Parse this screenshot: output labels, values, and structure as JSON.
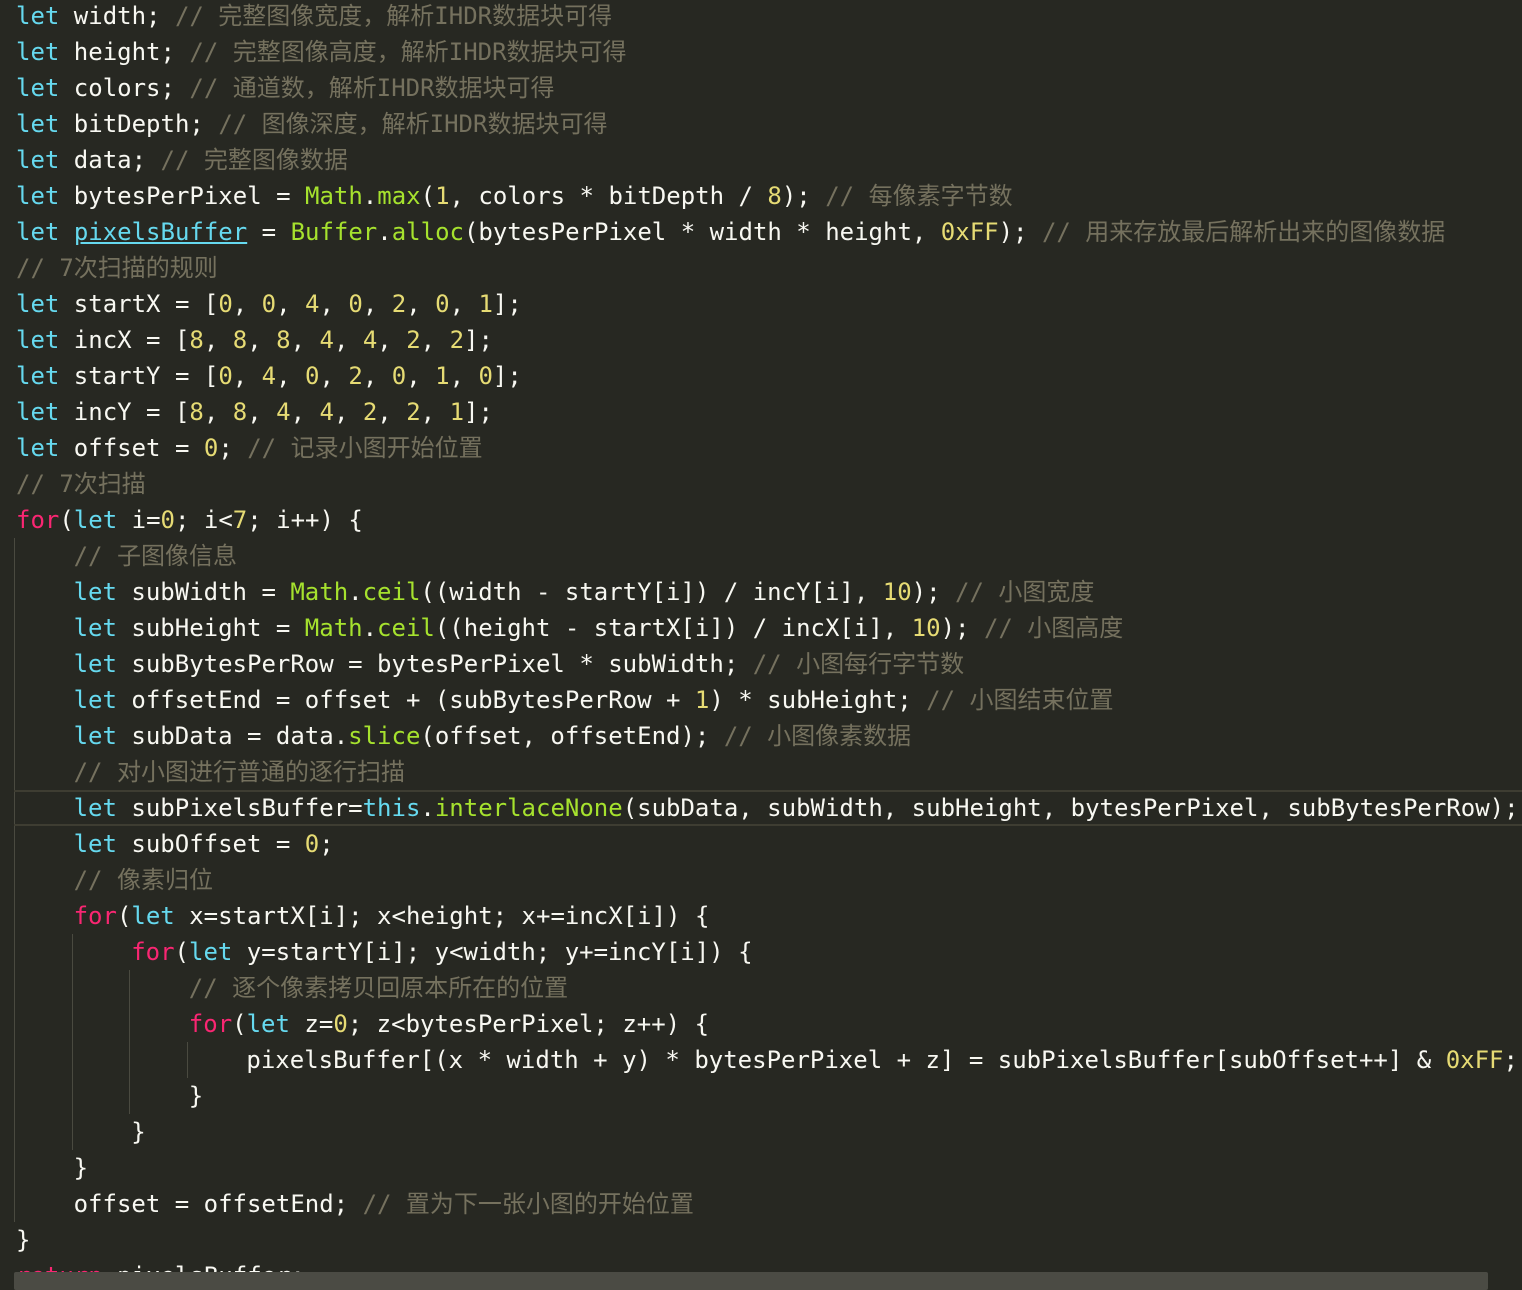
{
  "editor": {
    "language": "javascript",
    "colors": {
      "background": "#272822",
      "keyword": "#66d9ef",
      "control": "#f92672",
      "function": "#a6e22e",
      "number": "#e6db74",
      "comment": "#75715e",
      "text": "#f8f8f2"
    },
    "current_line_index": 22,
    "lines": [
      {
        "indent": 0,
        "tokens": [
          {
            "t": "let",
            "c": "kw"
          },
          {
            "t": " width; ",
            "c": "plain"
          },
          {
            "t": "// 完整图像宽度，解析IHDR数据块可得",
            "c": "cm"
          }
        ]
      },
      {
        "indent": 0,
        "tokens": [
          {
            "t": "let",
            "c": "kw"
          },
          {
            "t": " height; ",
            "c": "plain"
          },
          {
            "t": "// 完整图像高度，解析IHDR数据块可得",
            "c": "cm"
          }
        ]
      },
      {
        "indent": 0,
        "tokens": [
          {
            "t": "let",
            "c": "kw"
          },
          {
            "t": " colors; ",
            "c": "plain"
          },
          {
            "t": "// 通道数，解析IHDR数据块可得",
            "c": "cm"
          }
        ]
      },
      {
        "indent": 0,
        "tokens": [
          {
            "t": "let",
            "c": "kw"
          },
          {
            "t": " bitDepth; ",
            "c": "plain"
          },
          {
            "t": "// 图像深度，解析IHDR数据块可得",
            "c": "cm"
          }
        ]
      },
      {
        "indent": 0,
        "tokens": [
          {
            "t": "let",
            "c": "kw"
          },
          {
            "t": " data; ",
            "c": "plain"
          },
          {
            "t": "// 完整图像数据",
            "c": "cm"
          }
        ]
      },
      {
        "indent": 0,
        "tokens": [
          {
            "t": "let",
            "c": "kw"
          },
          {
            "t": " bytesPerPixel = ",
            "c": "plain"
          },
          {
            "t": "Math",
            "c": "fn"
          },
          {
            "t": ".",
            "c": "plain"
          },
          {
            "t": "max",
            "c": "fn"
          },
          {
            "t": "(",
            "c": "plain"
          },
          {
            "t": "1",
            "c": "num"
          },
          {
            "t": ", colors * bitDepth / ",
            "c": "plain"
          },
          {
            "t": "8",
            "c": "num"
          },
          {
            "t": "); ",
            "c": "plain"
          },
          {
            "t": "// 每像素字节数",
            "c": "cm"
          }
        ]
      },
      {
        "indent": 0,
        "tokens": [
          {
            "t": "let",
            "c": "kw"
          },
          {
            "t": " ",
            "c": "plain"
          },
          {
            "t": "pixelsBuffer",
            "c": "kwu"
          },
          {
            "t": " = ",
            "c": "plain"
          },
          {
            "t": "Buffer",
            "c": "fn"
          },
          {
            "t": ".",
            "c": "plain"
          },
          {
            "t": "alloc",
            "c": "fn"
          },
          {
            "t": "(bytesPerPixel * width * height, ",
            "c": "plain"
          },
          {
            "t": "0xFF",
            "c": "num"
          },
          {
            "t": "); ",
            "c": "plain"
          },
          {
            "t": "// 用来存放最后解析出来的图像数据",
            "c": "cm"
          }
        ]
      },
      {
        "indent": 0,
        "tokens": [
          {
            "t": "// 7次扫描的规则",
            "c": "cm"
          }
        ]
      },
      {
        "indent": 0,
        "tokens": [
          {
            "t": "let",
            "c": "kw"
          },
          {
            "t": " startX = [",
            "c": "plain"
          },
          {
            "t": "0",
            "c": "num"
          },
          {
            "t": ", ",
            "c": "plain"
          },
          {
            "t": "0",
            "c": "num"
          },
          {
            "t": ", ",
            "c": "plain"
          },
          {
            "t": "4",
            "c": "num"
          },
          {
            "t": ", ",
            "c": "plain"
          },
          {
            "t": "0",
            "c": "num"
          },
          {
            "t": ", ",
            "c": "plain"
          },
          {
            "t": "2",
            "c": "num"
          },
          {
            "t": ", ",
            "c": "plain"
          },
          {
            "t": "0",
            "c": "num"
          },
          {
            "t": ", ",
            "c": "plain"
          },
          {
            "t": "1",
            "c": "num"
          },
          {
            "t": "];",
            "c": "plain"
          }
        ]
      },
      {
        "indent": 0,
        "tokens": [
          {
            "t": "let",
            "c": "kw"
          },
          {
            "t": " incX = [",
            "c": "plain"
          },
          {
            "t": "8",
            "c": "num"
          },
          {
            "t": ", ",
            "c": "plain"
          },
          {
            "t": "8",
            "c": "num"
          },
          {
            "t": ", ",
            "c": "plain"
          },
          {
            "t": "8",
            "c": "num"
          },
          {
            "t": ", ",
            "c": "plain"
          },
          {
            "t": "4",
            "c": "num"
          },
          {
            "t": ", ",
            "c": "plain"
          },
          {
            "t": "4",
            "c": "num"
          },
          {
            "t": ", ",
            "c": "plain"
          },
          {
            "t": "2",
            "c": "num"
          },
          {
            "t": ", ",
            "c": "plain"
          },
          {
            "t": "2",
            "c": "num"
          },
          {
            "t": "];",
            "c": "plain"
          }
        ]
      },
      {
        "indent": 0,
        "tokens": [
          {
            "t": "let",
            "c": "kw"
          },
          {
            "t": " startY = [",
            "c": "plain"
          },
          {
            "t": "0",
            "c": "num"
          },
          {
            "t": ", ",
            "c": "plain"
          },
          {
            "t": "4",
            "c": "num"
          },
          {
            "t": ", ",
            "c": "plain"
          },
          {
            "t": "0",
            "c": "num"
          },
          {
            "t": ", ",
            "c": "plain"
          },
          {
            "t": "2",
            "c": "num"
          },
          {
            "t": ", ",
            "c": "plain"
          },
          {
            "t": "0",
            "c": "num"
          },
          {
            "t": ", ",
            "c": "plain"
          },
          {
            "t": "1",
            "c": "num"
          },
          {
            "t": ", ",
            "c": "plain"
          },
          {
            "t": "0",
            "c": "num"
          },
          {
            "t": "];",
            "c": "plain"
          }
        ]
      },
      {
        "indent": 0,
        "tokens": [
          {
            "t": "let",
            "c": "kw"
          },
          {
            "t": " incY = [",
            "c": "plain"
          },
          {
            "t": "8",
            "c": "num"
          },
          {
            "t": ", ",
            "c": "plain"
          },
          {
            "t": "8",
            "c": "num"
          },
          {
            "t": ", ",
            "c": "plain"
          },
          {
            "t": "4",
            "c": "num"
          },
          {
            "t": ", ",
            "c": "plain"
          },
          {
            "t": "4",
            "c": "num"
          },
          {
            "t": ", ",
            "c": "plain"
          },
          {
            "t": "2",
            "c": "num"
          },
          {
            "t": ", ",
            "c": "plain"
          },
          {
            "t": "2",
            "c": "num"
          },
          {
            "t": ", ",
            "c": "plain"
          },
          {
            "t": "1",
            "c": "num"
          },
          {
            "t": "];",
            "c": "plain"
          }
        ]
      },
      {
        "indent": 0,
        "tokens": [
          {
            "t": "let",
            "c": "kw"
          },
          {
            "t": " offset = ",
            "c": "plain"
          },
          {
            "t": "0",
            "c": "num"
          },
          {
            "t": "; ",
            "c": "plain"
          },
          {
            "t": "// 记录小图开始位置",
            "c": "cm"
          }
        ]
      },
      {
        "indent": 0,
        "tokens": [
          {
            "t": "// 7次扫描",
            "c": "cm"
          }
        ]
      },
      {
        "indent": 0,
        "tokens": [
          {
            "t": "for",
            "c": "ctrl"
          },
          {
            "t": "(",
            "c": "plain"
          },
          {
            "t": "let",
            "c": "kw"
          },
          {
            "t": " i=",
            "c": "plain"
          },
          {
            "t": "0",
            "c": "num"
          },
          {
            "t": "; i<",
            "c": "plain"
          },
          {
            "t": "7",
            "c": "num"
          },
          {
            "t": "; i++) {",
            "c": "plain"
          }
        ]
      },
      {
        "indent": 1,
        "tokens": [
          {
            "t": "// 子图像信息",
            "c": "cm"
          }
        ]
      },
      {
        "indent": 1,
        "tokens": [
          {
            "t": "let",
            "c": "kw"
          },
          {
            "t": " subWidth = ",
            "c": "plain"
          },
          {
            "t": "Math",
            "c": "fn"
          },
          {
            "t": ".",
            "c": "plain"
          },
          {
            "t": "ceil",
            "c": "fn"
          },
          {
            "t": "((width - startY[i]) / incY[i], ",
            "c": "plain"
          },
          {
            "t": "10",
            "c": "num"
          },
          {
            "t": "); ",
            "c": "plain"
          },
          {
            "t": "// 小图宽度",
            "c": "cm"
          }
        ]
      },
      {
        "indent": 1,
        "tokens": [
          {
            "t": "let",
            "c": "kw"
          },
          {
            "t": " subHeight = ",
            "c": "plain"
          },
          {
            "t": "Math",
            "c": "fn"
          },
          {
            "t": ".",
            "c": "plain"
          },
          {
            "t": "ceil",
            "c": "fn"
          },
          {
            "t": "((height - startX[i]) / incX[i], ",
            "c": "plain"
          },
          {
            "t": "10",
            "c": "num"
          },
          {
            "t": "); ",
            "c": "plain"
          },
          {
            "t": "// 小图高度",
            "c": "cm"
          }
        ]
      },
      {
        "indent": 1,
        "tokens": [
          {
            "t": "let",
            "c": "kw"
          },
          {
            "t": " subBytesPerRow = bytesPerPixel * subWidth; ",
            "c": "plain"
          },
          {
            "t": "// 小图每行字节数",
            "c": "cm"
          }
        ]
      },
      {
        "indent": 1,
        "tokens": [
          {
            "t": "let",
            "c": "kw"
          },
          {
            "t": " offsetEnd = offset + (subBytesPerRow + ",
            "c": "plain"
          },
          {
            "t": "1",
            "c": "num"
          },
          {
            "t": ") * subHeight; ",
            "c": "plain"
          },
          {
            "t": "// 小图结束位置",
            "c": "cm"
          }
        ]
      },
      {
        "indent": 1,
        "tokens": [
          {
            "t": "let",
            "c": "kw"
          },
          {
            "t": " subData = data.",
            "c": "plain"
          },
          {
            "t": "slice",
            "c": "fn"
          },
          {
            "t": "(offset, offsetEnd); ",
            "c": "plain"
          },
          {
            "t": "// 小图像素数据",
            "c": "cm"
          }
        ]
      },
      {
        "indent": 1,
        "tokens": [
          {
            "t": "// 对小图进行普通的逐行扫描",
            "c": "cm"
          }
        ]
      },
      {
        "indent": 1,
        "tokens": [
          {
            "t": "let",
            "c": "kw"
          },
          {
            "t": " subPixelsBuffer=",
            "c": "plain"
          },
          {
            "t": "this",
            "c": "kw"
          },
          {
            "t": ".",
            "c": "plain"
          },
          {
            "t": "interlaceNone",
            "c": "fn"
          },
          {
            "t": "(subData, subWidth, subHeight, bytesPerPixel, subBytesPerRow);",
            "c": "plain"
          }
        ]
      },
      {
        "indent": 1,
        "tokens": [
          {
            "t": "let",
            "c": "kw"
          },
          {
            "t": " subOffset = ",
            "c": "plain"
          },
          {
            "t": "0",
            "c": "num"
          },
          {
            "t": ";",
            "c": "plain"
          }
        ]
      },
      {
        "indent": 1,
        "tokens": [
          {
            "t": "// 像素归位",
            "c": "cm"
          }
        ]
      },
      {
        "indent": 1,
        "tokens": [
          {
            "t": "for",
            "c": "ctrl"
          },
          {
            "t": "(",
            "c": "plain"
          },
          {
            "t": "let",
            "c": "kw"
          },
          {
            "t": " x=startX[i]; x<height; x+=incX[i]) {",
            "c": "plain"
          }
        ]
      },
      {
        "indent": 2,
        "tokens": [
          {
            "t": "for",
            "c": "ctrl"
          },
          {
            "t": "(",
            "c": "plain"
          },
          {
            "t": "let",
            "c": "kw"
          },
          {
            "t": " y=startY[i]; y<width; y+=incY[i]) {",
            "c": "plain"
          }
        ]
      },
      {
        "indent": 3,
        "tokens": [
          {
            "t": "// 逐个像素拷贝回原本所在的位置",
            "c": "cm"
          }
        ]
      },
      {
        "indent": 3,
        "tokens": [
          {
            "t": "for",
            "c": "ctrl"
          },
          {
            "t": "(",
            "c": "plain"
          },
          {
            "t": "let",
            "c": "kw"
          },
          {
            "t": " z=",
            "c": "plain"
          },
          {
            "t": "0",
            "c": "num"
          },
          {
            "t": "; z<bytesPerPixel; z++) {",
            "c": "plain"
          }
        ]
      },
      {
        "indent": 4,
        "tokens": [
          {
            "t": "pixelsBuffer[(x * width + y) * bytesPerPixel + z] = subPixelsBuffer[subOffset++] & ",
            "c": "plain"
          },
          {
            "t": "0xFF",
            "c": "num"
          },
          {
            "t": ";",
            "c": "plain"
          }
        ]
      },
      {
        "indent": 3,
        "tokens": [
          {
            "t": "}",
            "c": "plain"
          }
        ]
      },
      {
        "indent": 2,
        "tokens": [
          {
            "t": "}",
            "c": "plain"
          }
        ]
      },
      {
        "indent": 1,
        "tokens": [
          {
            "t": "}",
            "c": "plain"
          }
        ]
      },
      {
        "indent": 1,
        "tokens": [
          {
            "t": "offset = offsetEnd; ",
            "c": "plain"
          },
          {
            "t": "// 置为下一张小图的开始位置",
            "c": "cm"
          }
        ]
      },
      {
        "indent": 0,
        "tokens": [
          {
            "t": "}",
            "c": "plain"
          }
        ]
      },
      {
        "indent": 0,
        "tokens": [
          {
            "t": "return",
            "c": "ctrl"
          },
          {
            "t": " pixelsBuffer;",
            "c": "plain"
          }
        ]
      }
    ]
  }
}
